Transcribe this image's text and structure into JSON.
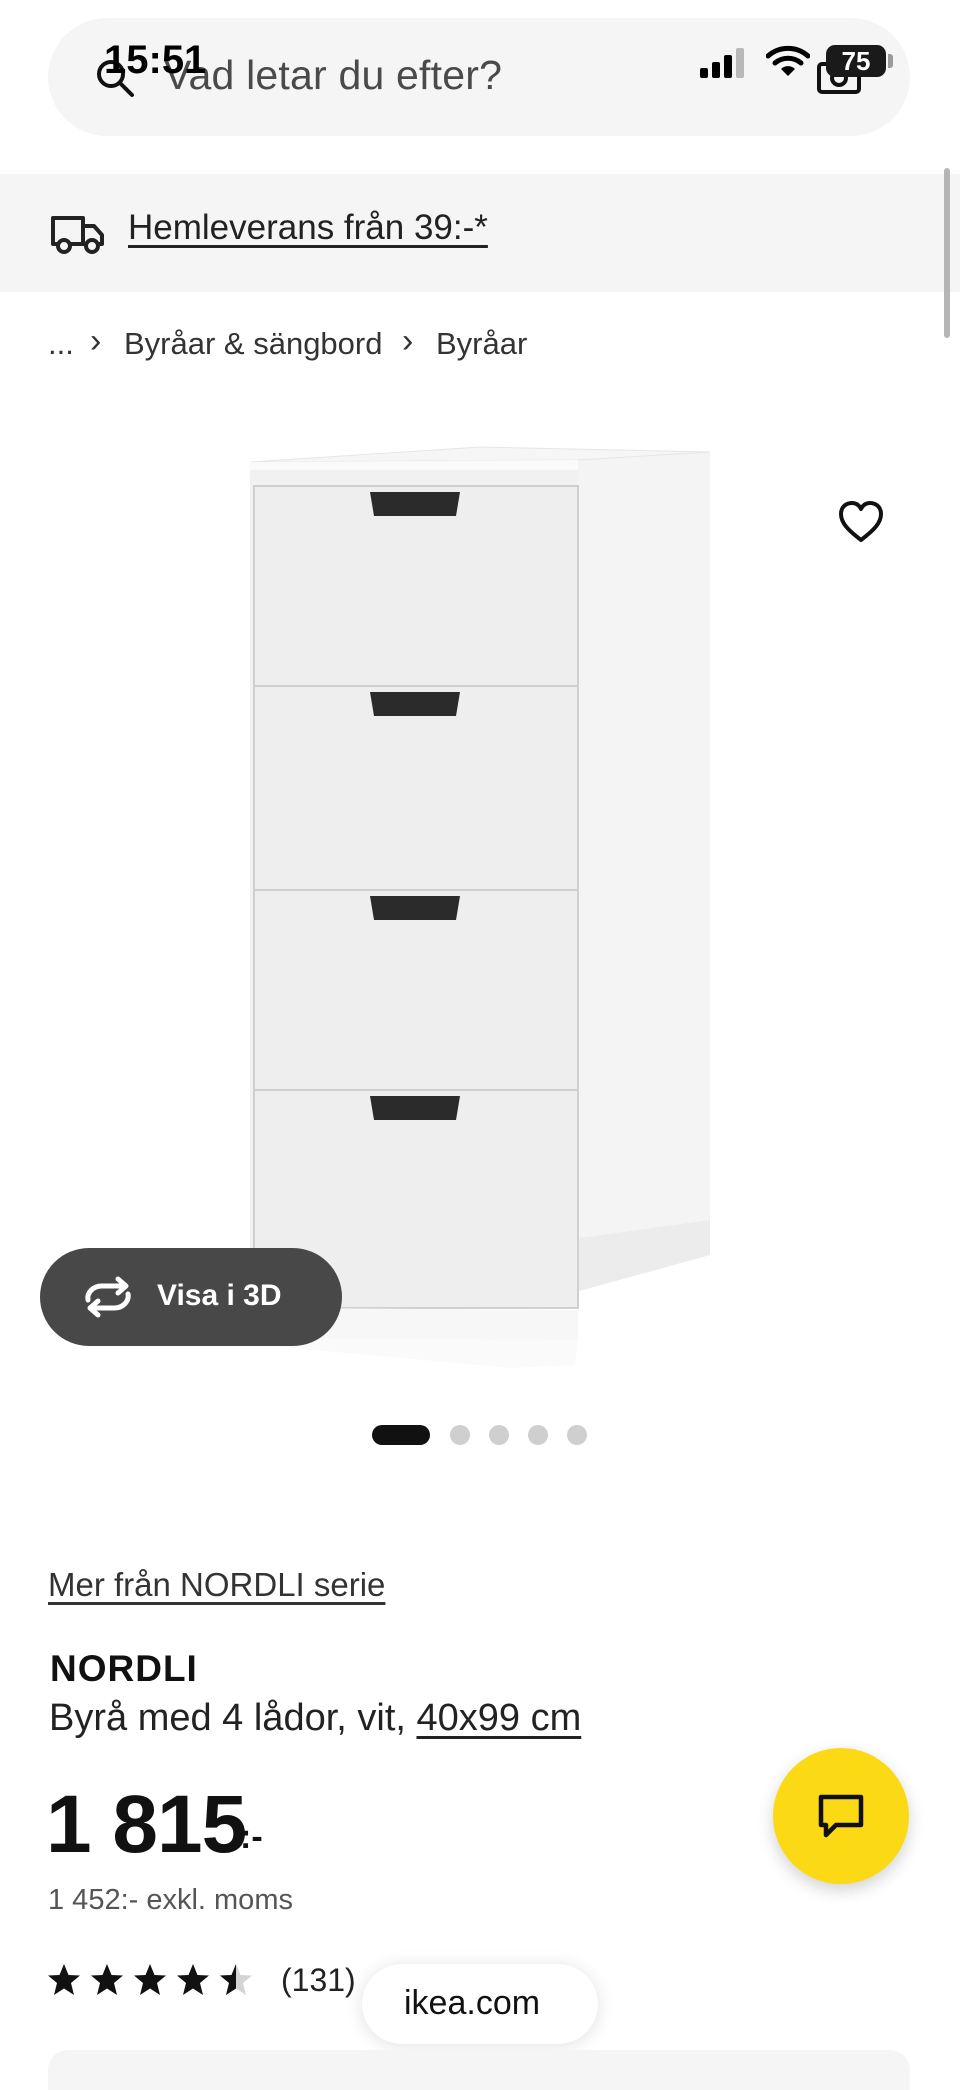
{
  "status_bar": {
    "time": "15:51",
    "battery": "75"
  },
  "search": {
    "placeholder": "Vad letar du efter?"
  },
  "delivery_banner": {
    "text": "Hemleverans från 39:-*"
  },
  "breadcrumb": {
    "ellipsis": "...",
    "items": [
      "Byråar & sängbord",
      "Byråar"
    ],
    "separator": "›"
  },
  "gallery": {
    "view_3d_label": "Visa i 3D",
    "dot_count": 5,
    "active_index": 0
  },
  "product": {
    "series_link": "Mer från NORDLI serie",
    "name": "NORDLI",
    "description": "Byrå med 4 lådor, vit,",
    "size": "40x99 cm",
    "price": "1 815",
    "price_suffix": ":-",
    "price_ex_vat": "1 452:- exkl. moms",
    "rating": 4.5,
    "rating_max": 5,
    "review_count": "(131)"
  },
  "browser": {
    "url": "ikea.com"
  },
  "colors": {
    "accent_yellow": "#fbd914",
    "button_dark": "#484848"
  }
}
